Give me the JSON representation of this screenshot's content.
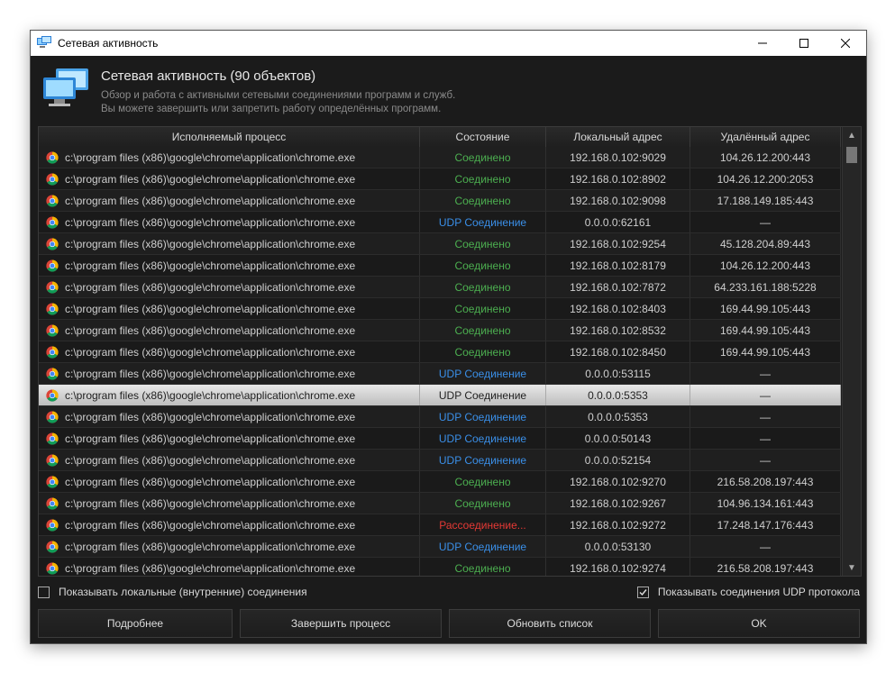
{
  "window": {
    "title": "Сетевая активность"
  },
  "header": {
    "title": "Сетевая активность (90 объектов)",
    "desc1": "Обзор и работа с активными сетевыми соединениями программ и служб.",
    "desc2": "Вы можете завершить или запретить работу определённых программ."
  },
  "table": {
    "columns": [
      "Исполняемый процесс",
      "Состояние",
      "Локальный адрес",
      "Удалённый адрес"
    ],
    "rows": [
      {
        "process": "c:\\program files (x86)\\google\\chrome\\application\\chrome.exe",
        "state": "Соединено",
        "state_type": "connected",
        "local": "192.168.0.102:9029",
        "remote": "104.26.12.200:443"
      },
      {
        "process": "c:\\program files (x86)\\google\\chrome\\application\\chrome.exe",
        "state": "Соединено",
        "state_type": "connected",
        "local": "192.168.0.102:8902",
        "remote": "104.26.12.200:2053"
      },
      {
        "process": "c:\\program files (x86)\\google\\chrome\\application\\chrome.exe",
        "state": "Соединено",
        "state_type": "connected",
        "local": "192.168.0.102:9098",
        "remote": "17.188.149.185:443"
      },
      {
        "process": "c:\\program files (x86)\\google\\chrome\\application\\chrome.exe",
        "state": "UDP Соединение",
        "state_type": "udp",
        "local": "0.0.0.0:62161",
        "remote": "—"
      },
      {
        "process": "c:\\program files (x86)\\google\\chrome\\application\\chrome.exe",
        "state": "Соединено",
        "state_type": "connected",
        "local": "192.168.0.102:9254",
        "remote": "45.128.204.89:443"
      },
      {
        "process": "c:\\program files (x86)\\google\\chrome\\application\\chrome.exe",
        "state": "Соединено",
        "state_type": "connected",
        "local": "192.168.0.102:8179",
        "remote": "104.26.12.200:443"
      },
      {
        "process": "c:\\program files (x86)\\google\\chrome\\application\\chrome.exe",
        "state": "Соединено",
        "state_type": "connected",
        "local": "192.168.0.102:7872",
        "remote": "64.233.161.188:5228"
      },
      {
        "process": "c:\\program files (x86)\\google\\chrome\\application\\chrome.exe",
        "state": "Соединено",
        "state_type": "connected",
        "local": "192.168.0.102:8403",
        "remote": "169.44.99.105:443"
      },
      {
        "process": "c:\\program files (x86)\\google\\chrome\\application\\chrome.exe",
        "state": "Соединено",
        "state_type": "connected",
        "local": "192.168.0.102:8532",
        "remote": "169.44.99.105:443"
      },
      {
        "process": "c:\\program files (x86)\\google\\chrome\\application\\chrome.exe",
        "state": "Соединено",
        "state_type": "connected",
        "local": "192.168.0.102:8450",
        "remote": "169.44.99.105:443"
      },
      {
        "process": "c:\\program files (x86)\\google\\chrome\\application\\chrome.exe",
        "state": "UDP Соединение",
        "state_type": "udp",
        "local": "0.0.0.0:53115",
        "remote": "—"
      },
      {
        "process": "c:\\program files (x86)\\google\\chrome\\application\\chrome.exe",
        "state": "UDP Соединение",
        "state_type": "udp",
        "local": "0.0.0.0:5353",
        "remote": "—",
        "selected": true
      },
      {
        "process": "c:\\program files (x86)\\google\\chrome\\application\\chrome.exe",
        "state": "UDP Соединение",
        "state_type": "udp",
        "local": "0.0.0.0:5353",
        "remote": "—"
      },
      {
        "process": "c:\\program files (x86)\\google\\chrome\\application\\chrome.exe",
        "state": "UDP Соединение",
        "state_type": "udp",
        "local": "0.0.0.0:50143",
        "remote": "—"
      },
      {
        "process": "c:\\program files (x86)\\google\\chrome\\application\\chrome.exe",
        "state": "UDP Соединение",
        "state_type": "udp",
        "local": "0.0.0.0:52154",
        "remote": "—"
      },
      {
        "process": "c:\\program files (x86)\\google\\chrome\\application\\chrome.exe",
        "state": "Соединено",
        "state_type": "connected",
        "local": "192.168.0.102:9270",
        "remote": "216.58.208.197:443"
      },
      {
        "process": "c:\\program files (x86)\\google\\chrome\\application\\chrome.exe",
        "state": "Соединено",
        "state_type": "connected",
        "local": "192.168.0.102:9267",
        "remote": "104.96.134.161:443"
      },
      {
        "process": "c:\\program files (x86)\\google\\chrome\\application\\chrome.exe",
        "state": "Рассоединение...",
        "state_type": "disconnecting",
        "local": "192.168.0.102:9272",
        "remote": "17.248.147.176:443"
      },
      {
        "process": "c:\\program files (x86)\\google\\chrome\\application\\chrome.exe",
        "state": "UDP Соединение",
        "state_type": "udp",
        "local": "0.0.0.0:53130",
        "remote": "—"
      },
      {
        "process": "c:\\program files (x86)\\google\\chrome\\application\\chrome.exe",
        "state": "Соединено",
        "state_type": "connected",
        "local": "192.168.0.102:9274",
        "remote": "216.58.208.197:443"
      }
    ]
  },
  "options": {
    "show_local": {
      "label": "Показывать локальные (внутренние) соединения",
      "checked": false
    },
    "show_udp": {
      "label": "Показывать соединения UDP протокола",
      "checked": true
    }
  },
  "buttons": {
    "details": "Подробнее",
    "kill": "Завершить процесс",
    "refresh": "Обновить список",
    "ok": "OK"
  },
  "colors": {
    "connected": "#4caf50",
    "udp": "#3a8fe8",
    "disconnecting": "#e53935"
  }
}
